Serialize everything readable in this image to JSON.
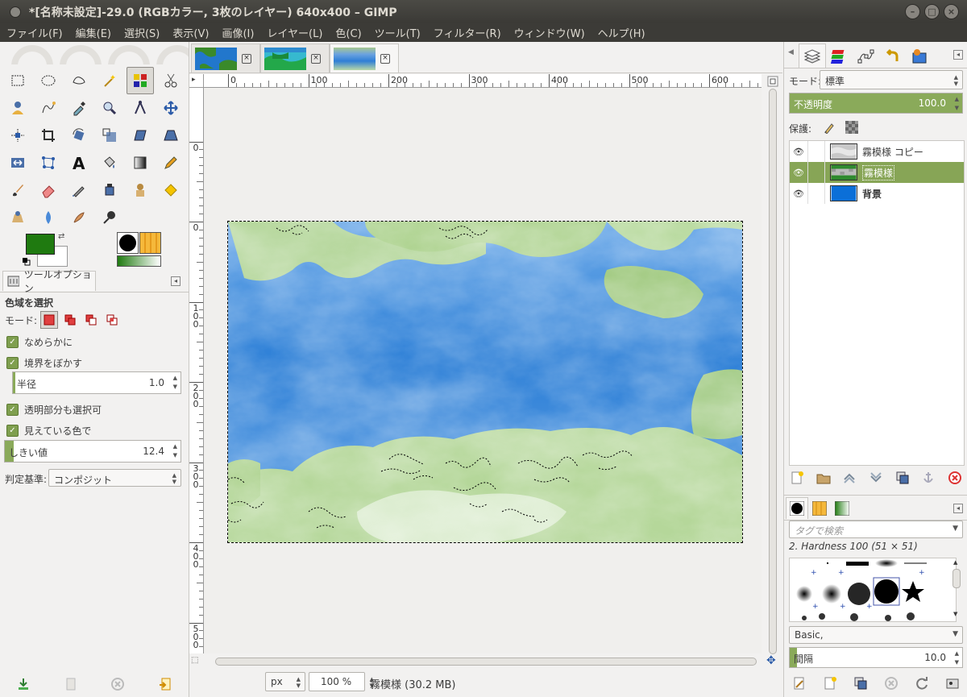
{
  "window": {
    "title": "*[名称未設定]-29.0 (RGBカラー, 3枚のレイヤー) 640x400 – GIMP",
    "buttons": [
      "minimize",
      "maximize",
      "close"
    ]
  },
  "menu": [
    "ファイル(F)",
    "編集(E)",
    "選択(S)",
    "表示(V)",
    "画像(I)",
    "レイヤー(L)",
    "色(C)",
    "ツール(T)",
    "フィルター(R)",
    "ウィンドウ(W)",
    "ヘルプ(H)"
  ],
  "toolbox": {
    "tools": [
      {
        "name": "rect-select-icon"
      },
      {
        "name": "ellipse-select-icon"
      },
      {
        "name": "free-select-icon"
      },
      {
        "name": "fuzzy-select-icon"
      },
      {
        "name": "select-by-color-icon",
        "active": true
      },
      {
        "name": "scissors-select-icon"
      },
      {
        "name": "foreground-select-icon"
      },
      {
        "name": "paths-icon"
      },
      {
        "name": "color-picker-icon"
      },
      {
        "name": "zoom-icon"
      },
      {
        "name": "measure-icon"
      },
      {
        "name": "move-icon"
      },
      {
        "name": "align-icon"
      },
      {
        "name": "crop-icon"
      },
      {
        "name": "rotate-icon"
      },
      {
        "name": "scale-icon"
      },
      {
        "name": "shear-icon"
      },
      {
        "name": "perspective-icon"
      },
      {
        "name": "flip-icon"
      },
      {
        "name": "cage-transform-icon"
      },
      {
        "name": "text-icon"
      },
      {
        "name": "bucket-fill-icon"
      },
      {
        "name": "blend-icon"
      },
      {
        "name": "pencil-icon"
      },
      {
        "name": "paintbrush-icon"
      },
      {
        "name": "eraser-icon"
      },
      {
        "name": "airbrush-icon"
      },
      {
        "name": "ink-icon"
      },
      {
        "name": "clone-icon"
      },
      {
        "name": "heal-icon"
      },
      {
        "name": "perspective-clone-icon"
      },
      {
        "name": "blur-icon"
      },
      {
        "name": "smudge-icon"
      },
      {
        "name": "dodge-burn-icon"
      }
    ],
    "colors": {
      "foreground": "#1f7a10",
      "background": "#ffffff"
    }
  },
  "tool_options": {
    "tab_label": "ツールオプション",
    "title": "色域を選択",
    "mode_label": "モード:",
    "antialias": {
      "label": "なめらかに",
      "checked": true
    },
    "feather": {
      "label": "境界をぼかす",
      "checked": true
    },
    "radius": {
      "label": "半径",
      "value": "1.0"
    },
    "select_transparent": {
      "label": "透明部分も選択可",
      "checked": true
    },
    "sample_merged": {
      "label": "見えている色で",
      "checked": true
    },
    "threshold": {
      "label": "しきい値",
      "value": "12.4",
      "fill": 0.05
    },
    "criterion": {
      "label": "判定基準:",
      "value": "コンポジット"
    }
  },
  "rulers": {
    "horizontal": [
      "0",
      "100",
      "200",
      "300",
      "400",
      "500",
      "600"
    ],
    "vertical": [
      "0",
      "100",
      "200",
      "300",
      "400",
      "500"
    ],
    "vertical_top": "0"
  },
  "statusbar": {
    "unit": "px",
    "zoom": "100 %",
    "info": "霧模様 (30.2 MB)"
  },
  "layers_panel": {
    "mode_label": "モード:",
    "mode_value": "標準",
    "opacity_label": "不透明度",
    "opacity_value": "100.0",
    "lock_label": "保護:",
    "layers": [
      {
        "name": "霧模様 コピー",
        "selected": false
      },
      {
        "name": "霧模様",
        "selected": true
      },
      {
        "name": "背景",
        "selected": false
      }
    ]
  },
  "brushes_panel": {
    "tag_placeholder": "タグで検索",
    "brush_name": "2. Hardness 100 (51 × 51)",
    "preset": "Basic,",
    "spacing_label": "間隔",
    "spacing_value": "10.0"
  }
}
